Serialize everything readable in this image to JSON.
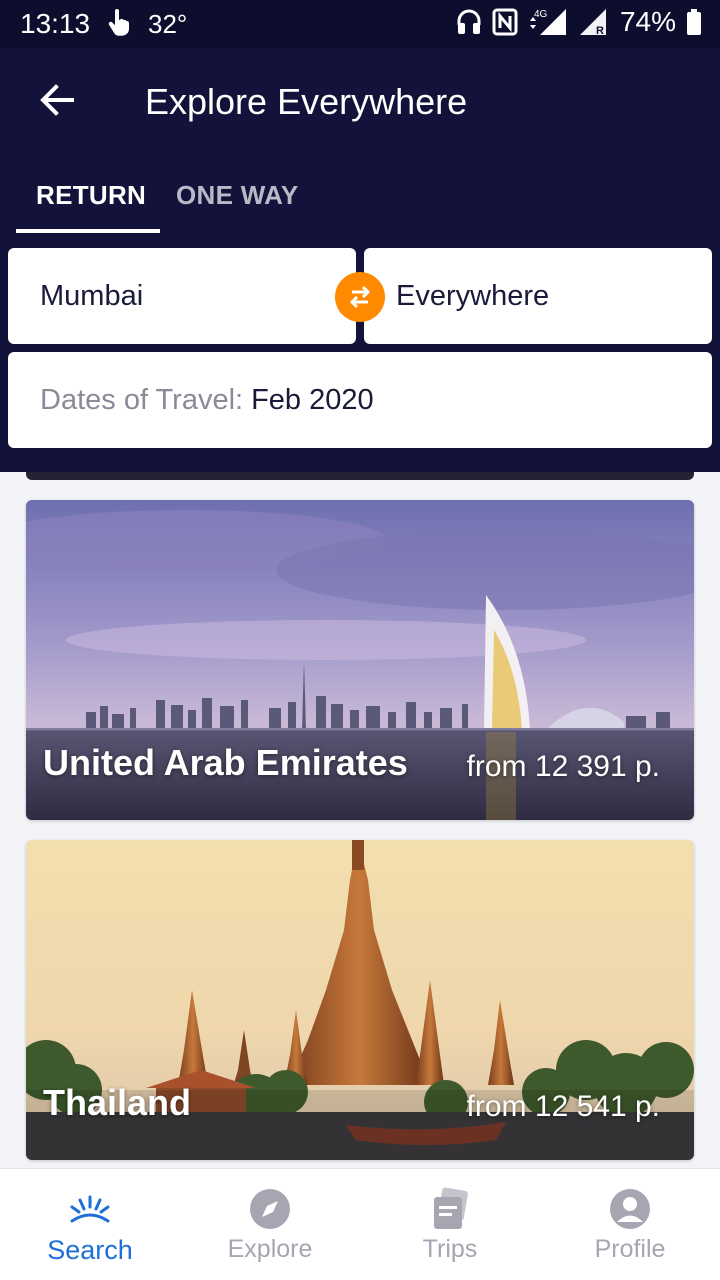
{
  "status_bar": {
    "time": "13:13",
    "temperature": "32°",
    "battery": "74%",
    "icons": [
      "touch-hand-icon",
      "headphones-icon",
      "nfc-icon",
      "4g-signal-icon",
      "roaming-signal-icon",
      "battery-icon"
    ]
  },
  "header": {
    "title": "Explore Everywhere",
    "back_icon": "arrow-left-icon",
    "tabs": [
      {
        "label": "RETURN",
        "active": true
      },
      {
        "label": "ONE WAY",
        "active": false
      }
    ]
  },
  "search": {
    "from": "Mumbai",
    "to": "Everywhere",
    "swap_icon": "swap-arrows-icon",
    "dates_label": "Dates of Travel:",
    "dates_value": "Feb 2020"
  },
  "destinations": [
    {
      "name": "United Arab Emirates",
      "price": "from 12 391 р."
    },
    {
      "name": "Thailand",
      "price": "from 12 541 р."
    }
  ],
  "bottom_nav": [
    {
      "label": "Search",
      "icon": "sunrise-icon",
      "active": true
    },
    {
      "label": "Explore",
      "icon": "compass-icon",
      "active": false
    },
    {
      "label": "Trips",
      "icon": "tickets-icon",
      "active": false
    },
    {
      "label": "Profile",
      "icon": "user-icon",
      "active": false
    }
  ],
  "colors": {
    "header_bg": "#13123a",
    "accent_orange": "#ff8a00",
    "active_blue": "#1e6fd9",
    "inactive_grey": "#a6a6b2"
  }
}
